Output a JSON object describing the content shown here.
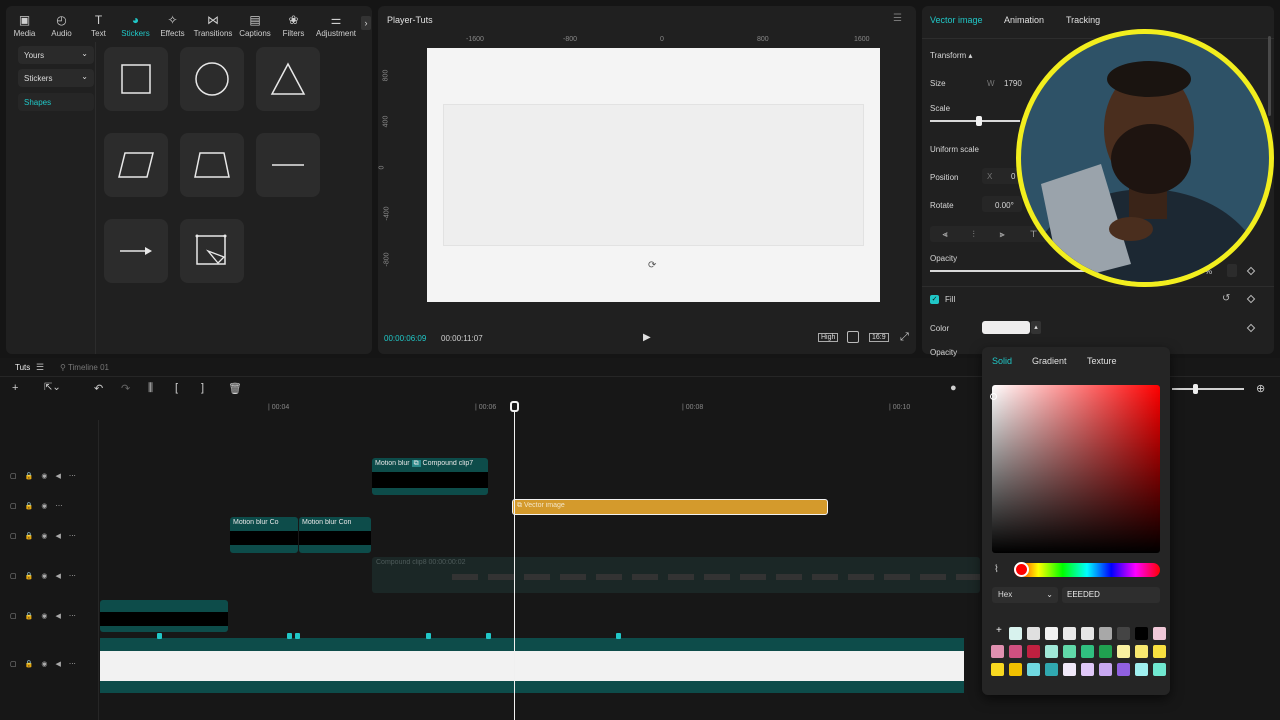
{
  "toolbar": {
    "items": [
      {
        "label": "Media",
        "icon": "media-icon",
        "glyph": "▣"
      },
      {
        "label": "Audio",
        "icon": "audio-icon",
        "glyph": "◴"
      },
      {
        "label": "Text",
        "icon": "text-icon",
        "glyph": "T"
      },
      {
        "label": "Stickers",
        "icon": "stickers-icon",
        "glyph": "◕"
      },
      {
        "label": "Effects",
        "icon": "effects-icon",
        "glyph": "✧"
      },
      {
        "label": "Transitions",
        "icon": "transitions-icon",
        "glyph": "⋈"
      },
      {
        "label": "Captions",
        "icon": "captions-icon",
        "glyph": "▤"
      },
      {
        "label": "Filters",
        "icon": "filters-icon",
        "glyph": "❀"
      },
      {
        "label": "Adjustment",
        "icon": "adjustment-icon",
        "glyph": "⚌"
      }
    ],
    "more_glyph": "›"
  },
  "sidebar": {
    "yours": "Yours",
    "stickers": "Stickers",
    "shapes": "Shapes",
    "chev": "⌄"
  },
  "player": {
    "title": "Player-Tuts",
    "menu_glyph": "☰",
    "current_time": "00:00:06:09",
    "total_time": "00:00:11:07",
    "quality": "High",
    "ratio": "16:9",
    "ruler_h": [
      "-1600",
      "-800",
      "0",
      "800",
      "1600"
    ],
    "ruler_v": [
      "800",
      "400",
      "0",
      "-400",
      "-800"
    ],
    "play_glyph": "▶"
  },
  "inspector": {
    "tabs": {
      "vector": "Vector image",
      "animation": "Animation",
      "tracking": "Tracking"
    },
    "transform": "Transform ▴",
    "size": "Size",
    "w": "W",
    "w_value": "1790",
    "scale": "Scale",
    "uniform": "Uniform scale",
    "position": "Position",
    "x": "X",
    "x_value": "0",
    "rotate": "Rotate",
    "rotate_value": "0.00°",
    "opacity": "Opacity",
    "opacity_pct": "%",
    "fill": "Fill",
    "color": "Color",
    "opacity2": "Opacity"
  },
  "color_picker": {
    "tabs": {
      "solid": "Solid",
      "gradient": "Gradient",
      "texture": "Texture"
    },
    "mode": "Hex",
    "hex": "EEEDED",
    "add": "+",
    "swatches": [
      [
        "#d8f2ee",
        "#e0e0e0",
        "#f2f2f2",
        "#e8e8e8",
        "#e6e6e6",
        "#a8a8a8",
        "#444444",
        "#000000",
        "#f0c8d8"
      ],
      [
        "#e090b0",
        "#d05080",
        "#c02040",
        "#a0e8d8",
        "#60d8a8",
        "#30c080",
        "#20a050",
        "#f8f0a0",
        "#f8e870",
        "#f8e040"
      ],
      [
        "#f8d820",
        "#f0c000",
        "#70d8e0",
        "#30a8b0",
        "#f0e8f8",
        "#e0c8f8",
        "#c8a8f0",
        "#9060e0",
        "#a0f0f0",
        "#70e8d0"
      ]
    ]
  },
  "timeline": {
    "tab": "Tuts",
    "timeline_tab": "Timeline 01",
    "ticks": [
      "| 00:04",
      "| 00:06",
      "| 00:08",
      "| 00:10"
    ],
    "clips": {
      "motion_blur": "Motion blur",
      "compound7": "Compound clip7",
      "co": "Co",
      "con": "Con",
      "vector_image": "Vector image",
      "compound_dim": "Compound clip8  00:00:00:02"
    }
  },
  "colors": {
    "accent": "#20c7c7",
    "clip_teal": "#0d4c4a",
    "vector_clip": "#d49a2c",
    "yellow_ring": "#f2ee1e"
  }
}
